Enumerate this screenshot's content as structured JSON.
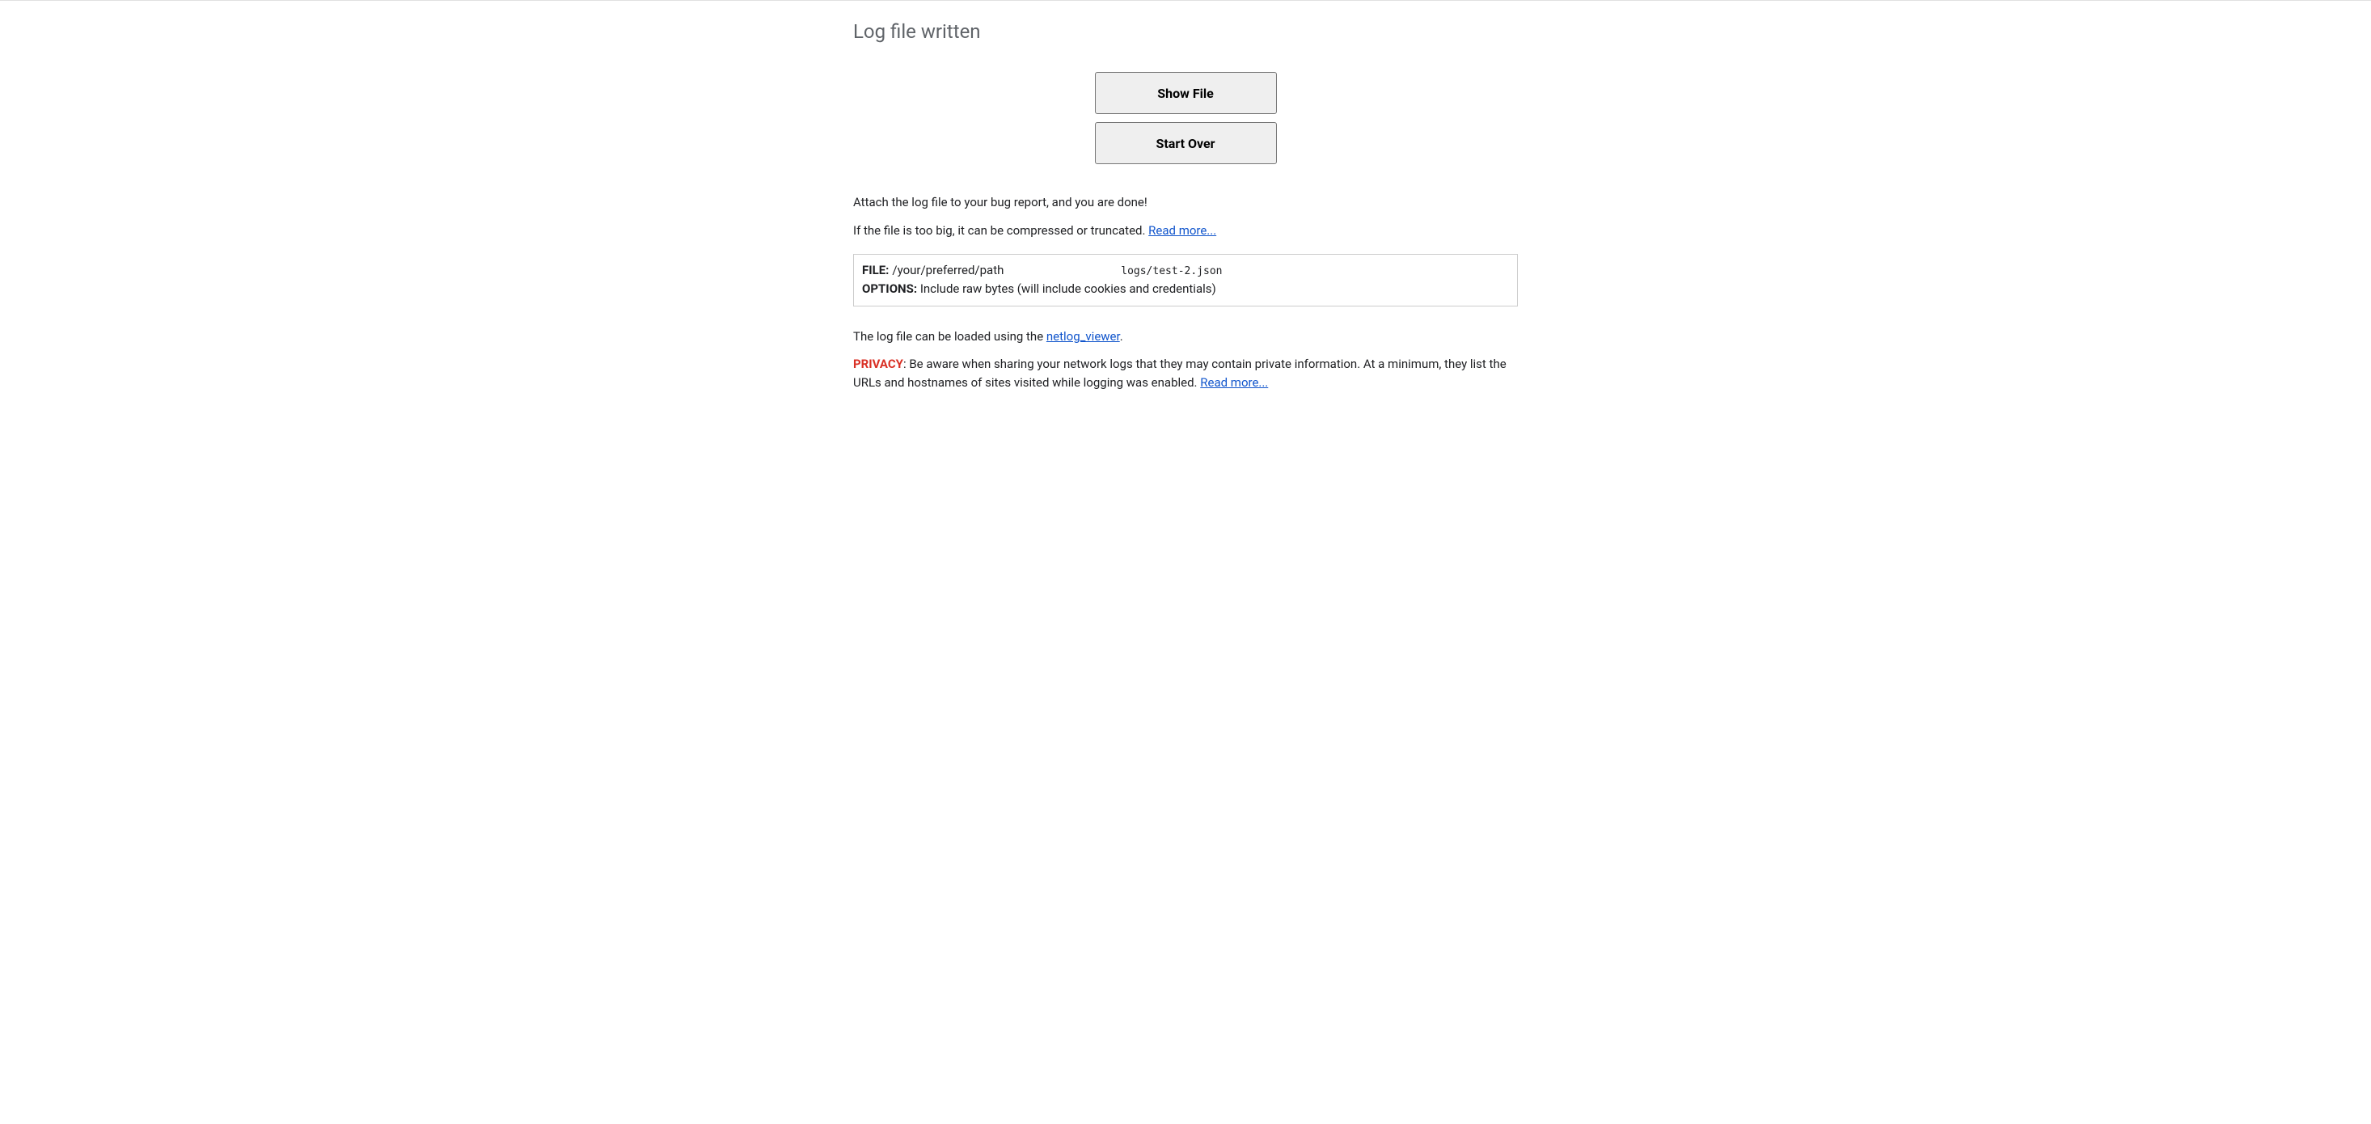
{
  "header": {
    "title": "Log file written"
  },
  "buttons": {
    "show_file": "Show File",
    "start_over": "Start Over"
  },
  "body": {
    "attach_text": "Attach the log file to your bug report, and you are done!",
    "too_big_prefix": "If the file is too big, it can be compressed or truncated. ",
    "read_more_label": "Read more..."
  },
  "infobox": {
    "file_label": "FILE:",
    "file_path_prefix": " /your/preferred/path",
    "file_path_mono": "                  logs/test-2.json",
    "options_label": "OPTIONS:",
    "options_value": " Include raw bytes (will include cookies and credentials)"
  },
  "viewer": {
    "prefix": "The log file can be loaded using the ",
    "link_label": "netlog_viewer",
    "suffix": "."
  },
  "privacy": {
    "label": "PRIVACY",
    "text": ": Be aware when sharing your network logs that they may contain private information. At a minimum, they list the URLs and hostnames of sites visited while logging was enabled. ",
    "read_more_label": "Read more..."
  }
}
